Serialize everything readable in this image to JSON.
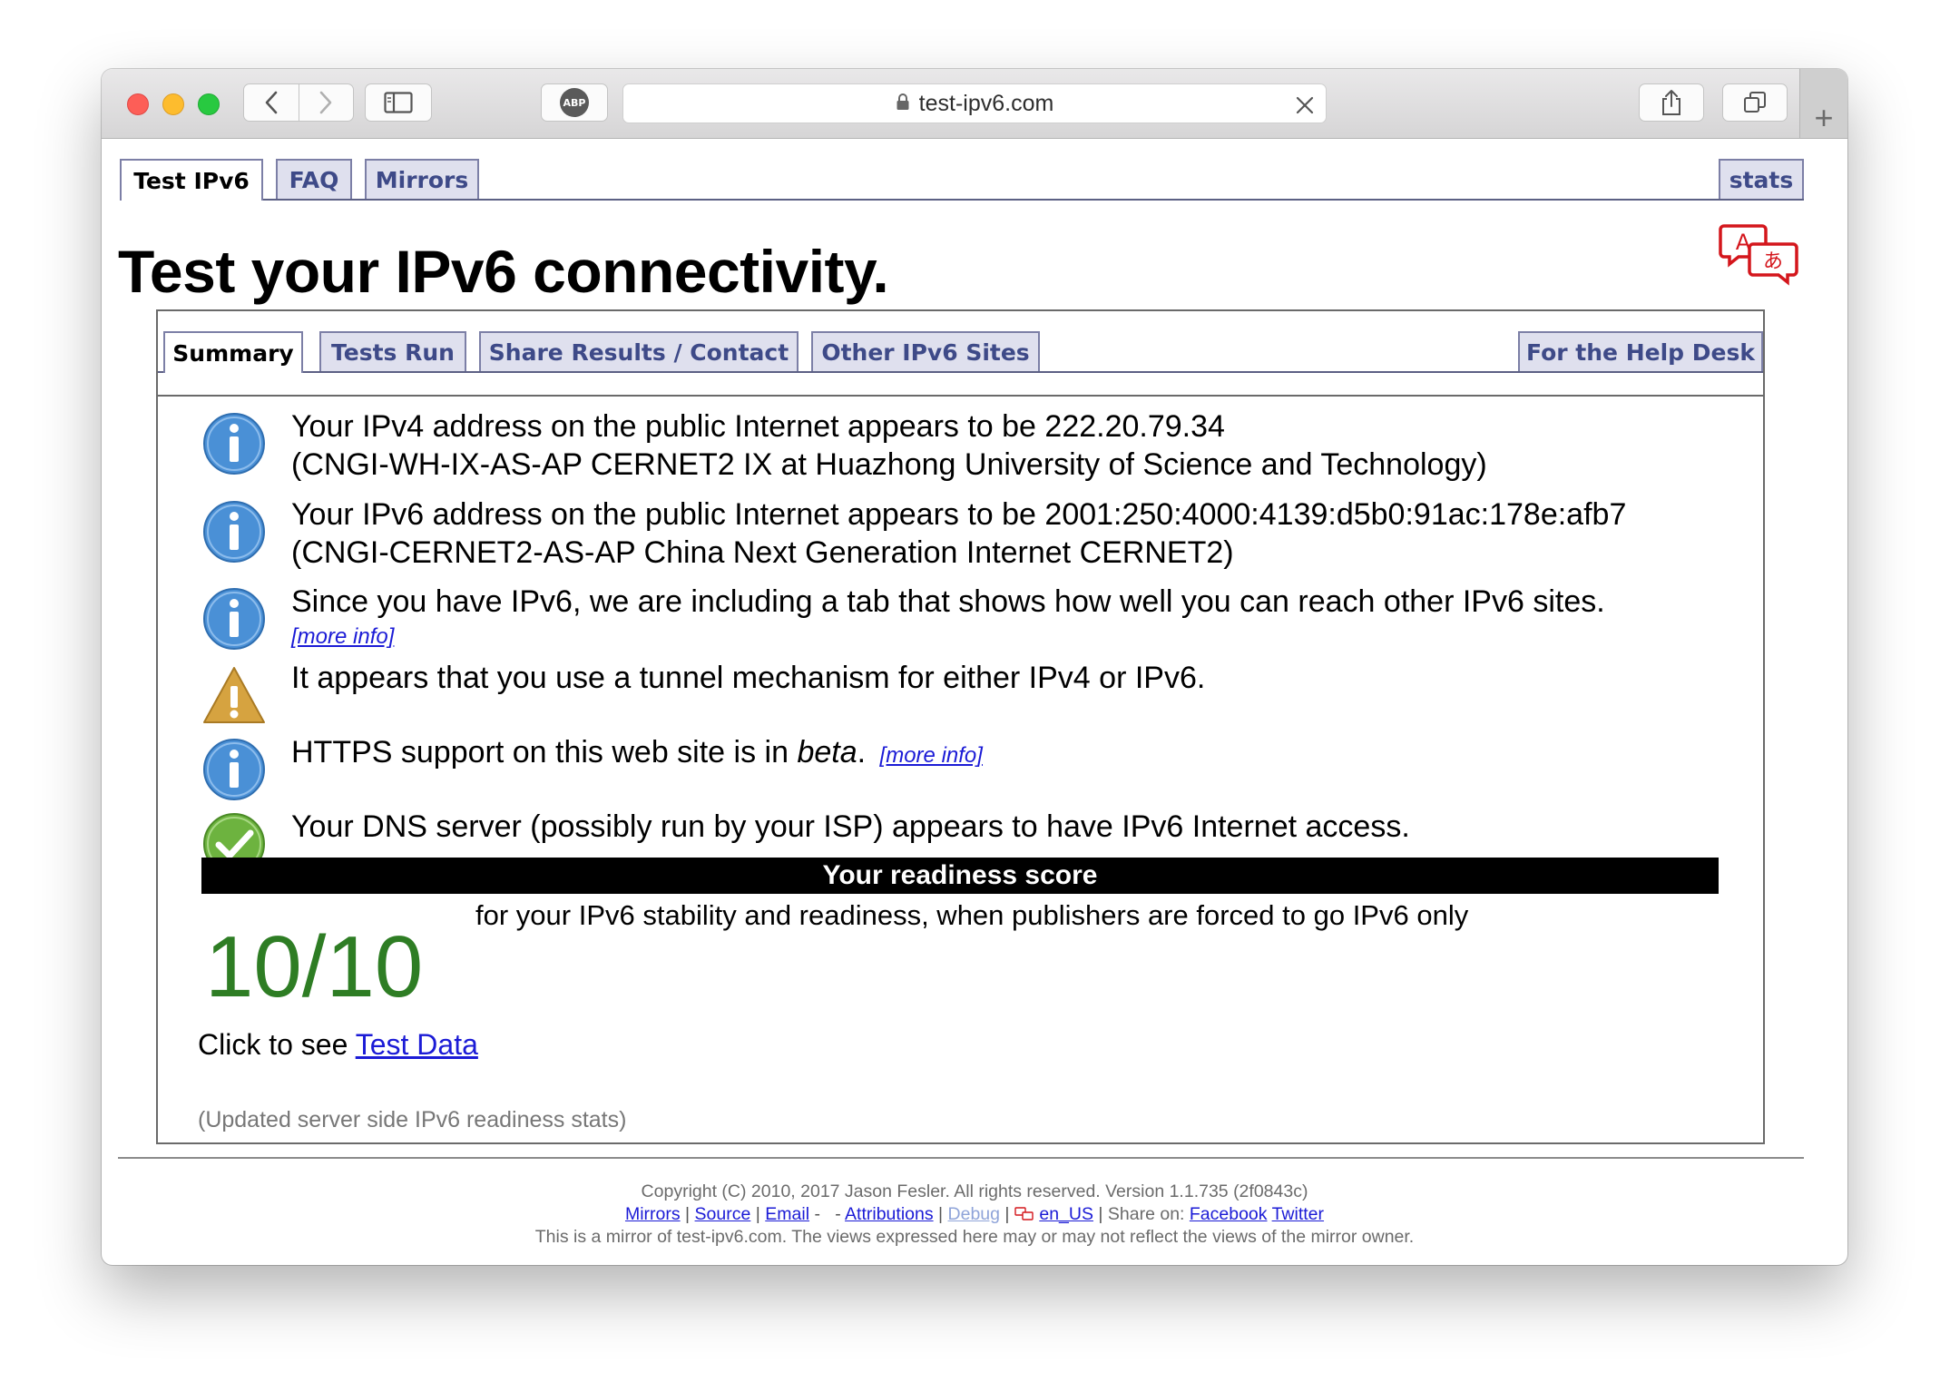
{
  "browser": {
    "url": "test-ipv6.com",
    "adblock_label": "ABP"
  },
  "top_tabs": {
    "test_ipv6": "Test IPv6",
    "faq": "FAQ",
    "mirrors": "Mirrors",
    "stats": "stats"
  },
  "page_title": "Test your IPv6 connectivity.",
  "inner_tabs": {
    "summary": "Summary",
    "tests_run": "Tests Run",
    "share_results": "Share Results / Contact",
    "other_sites": "Other IPv6 Sites",
    "help_desk": "For the Help Desk"
  },
  "messages": {
    "ipv4_line1": "Your IPv4 address on the public Internet appears to be 222.20.79.34",
    "ipv4_line2": "(CNGI-WH-IX-AS-AP CERNET2 IX at Huazhong University of Science and Technology)",
    "ipv6_line1": "Your IPv6 address on the public Internet appears to be 2001:250:4000:4139:d5b0:91ac:178e:afb7",
    "ipv6_line2": "(CNGI-CERNET2-AS-AP China Next Generation Internet CERNET2)",
    "ipv6_tab_note": "Since you have IPv6, we are including a tab that shows how well you can reach other IPv6 sites.",
    "more_info": "[more info]",
    "tunnel_warning": "It appears that you use a tunnel mechanism for either IPv4 or IPv6.",
    "https_prefix": "HTTPS support on this web site is in ",
    "https_beta": "beta",
    "https_suffix": ".",
    "dns": "Your DNS server (possibly run by your ISP) appears to have IPv6 Internet access."
  },
  "score": {
    "header": "Your readiness score",
    "value": "10/10",
    "description": "for your IPv6 stability and readiness, when publishers are forced to go IPv6 only"
  },
  "test_data": {
    "prefix": "Click to see ",
    "link": "Test Data"
  },
  "updated_stats": "(Updated server side IPv6 readiness stats)",
  "footer": {
    "copyright": "Copyright (C) 2010, 2017 Jason Fesler. All rights reserved. Version 1.1.735 (2f0843c)",
    "mirrors": "Mirrors",
    "source": "Source",
    "email": "Email",
    "attributions": "Attributions",
    "debug": "Debug",
    "locale": "en_US",
    "share_on": "Share on:",
    "facebook": "Facebook",
    "twitter": "Twitter",
    "mirror_note": "This is a mirror of test-ipv6.com. The views expressed here may or may not reflect the views of the mirror owner."
  },
  "colors": {
    "info_blue": "#4a90d6",
    "warning_gold": "#d6a340",
    "ok_green": "#6db33f",
    "score_green": "#2e7d24",
    "tab_text": "#3e4a88"
  }
}
